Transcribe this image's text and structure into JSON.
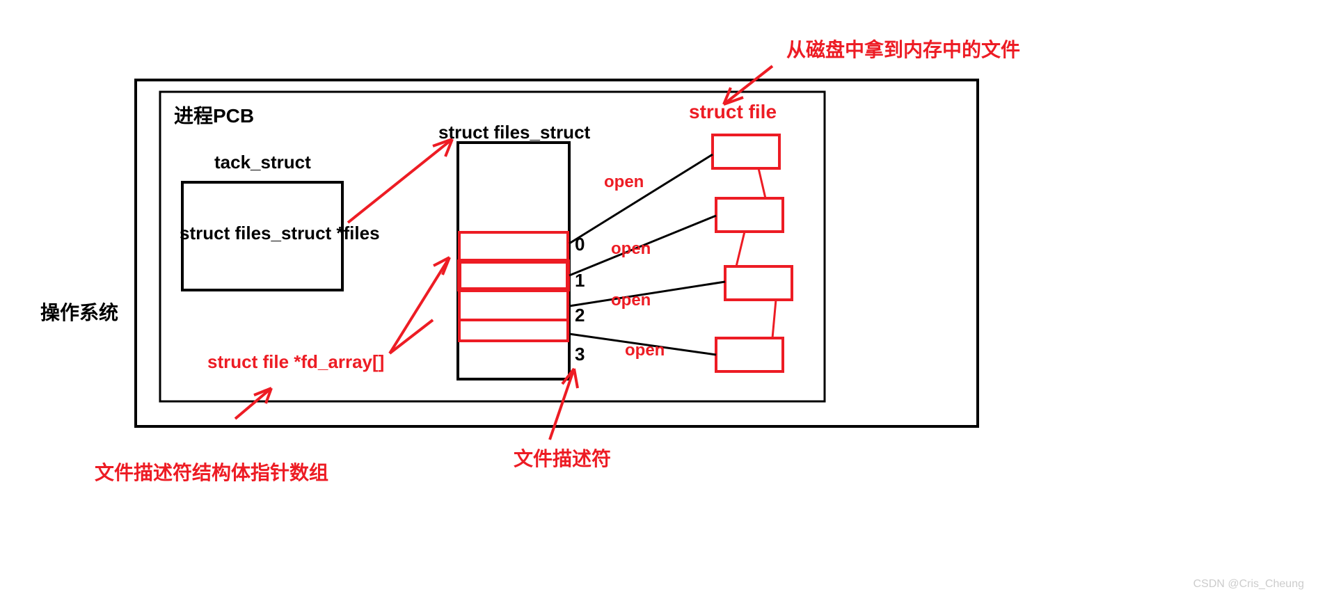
{
  "labels": {
    "os": "操作系统",
    "pcb": "进程PCB",
    "task_struct": "tack_struct",
    "files_ptr": "struct files_struct *files",
    "files_struct_title": "struct files_struct",
    "fd_array": "struct file *fd_array[]",
    "struct_file": "struct file",
    "top_note": "从磁盘中拿到内存中的文件",
    "fd_note_left": "文件描述符结构体指针数组",
    "fd_note_right": "文件描述符",
    "index0": "0",
    "index1": "1",
    "index2": "2",
    "index3": "3",
    "open0": "open",
    "open1": "open",
    "open2": "open",
    "open3": "open",
    "watermark": "CSDN @Cris_Cheung"
  }
}
